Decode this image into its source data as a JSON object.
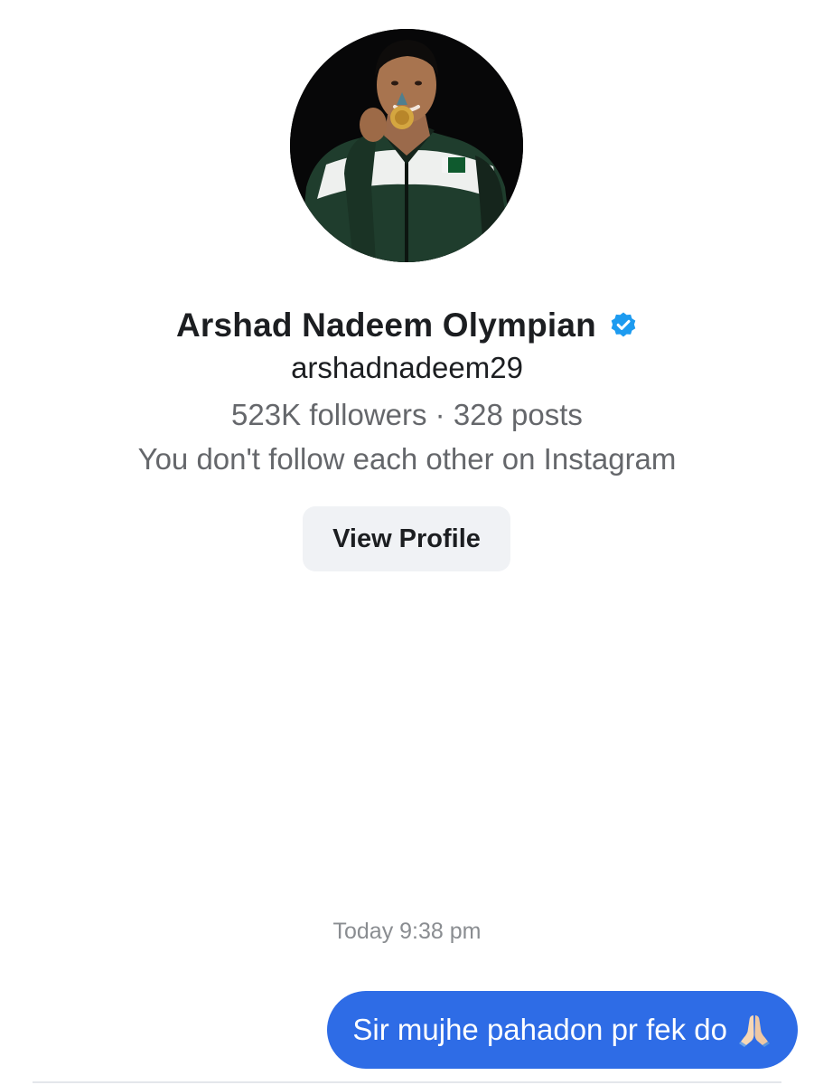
{
  "profile": {
    "avatar_icon": "profile-photo-athlete-with-gold-medal",
    "name": "Arshad Nadeem Olympian",
    "verified_icon": "verified-badge-icon",
    "username": "arshadnadeem29",
    "stats": "523K followers · 328 posts",
    "follow_status": "You don't follow each other on Instagram",
    "view_profile_label": "View Profile"
  },
  "conversation": {
    "timestamp": "Today 9:38 pm",
    "messages": [
      {
        "direction": "outgoing",
        "text": "Sir mujhe pahadon pr fek do",
        "emoji_icon": "folded-hands-emoji"
      }
    ]
  },
  "colors": {
    "accent_blue": "#2e6ce6",
    "verified_blue": "#1d9bf0",
    "secondary_text": "#65676b",
    "button_bg": "#f0f2f5"
  }
}
